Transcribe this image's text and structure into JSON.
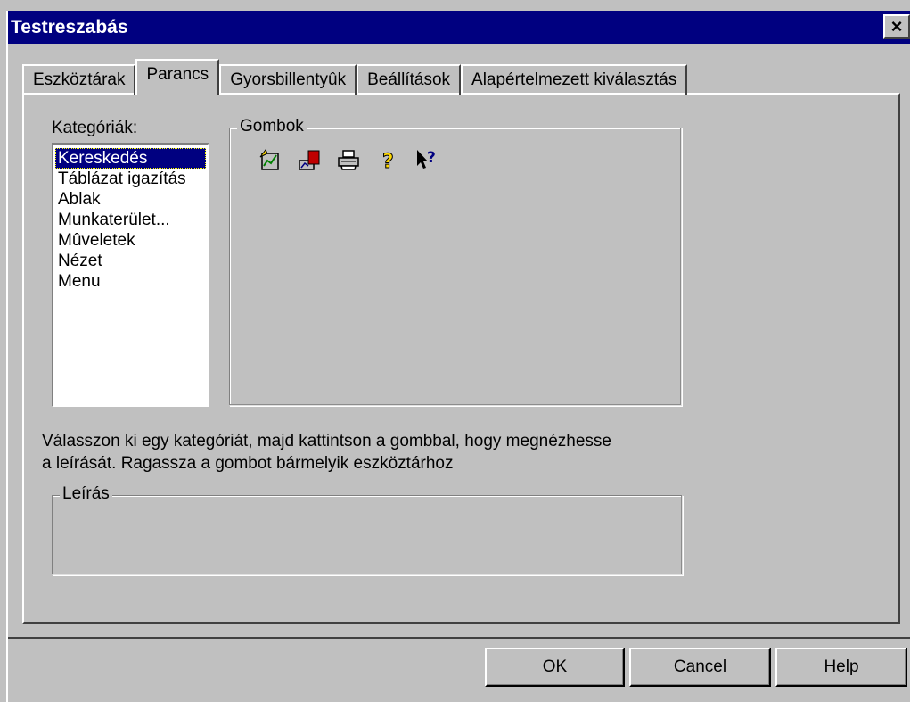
{
  "window": {
    "title": "Testreszabás",
    "close_label": "×"
  },
  "tabs": [
    {
      "label": "Eszköztárak"
    },
    {
      "label": "Parancs"
    },
    {
      "label": "Gyorsbillentyûk"
    },
    {
      "label": "Beállítások"
    },
    {
      "label": "Alapértelmezett kiválasztás"
    }
  ],
  "categories": {
    "label": "Kategóriák:",
    "items": [
      "Kereskedés",
      "Táblázat igazítás",
      "Ablak",
      "Munkaterület...",
      "Mûveletek",
      "Nézet",
      "Menu"
    ]
  },
  "buttons_group": {
    "title": "Gombok",
    "icons": [
      "trade-chart-icon",
      "chart-export-icon",
      "print-icon",
      "help-icon",
      "context-help-icon"
    ]
  },
  "instruction": {
    "line1": "Válasszon ki egy kategóriát, majd kattintson a gombbal, hogy megnézhesse",
    "line2": "a leírását. Ragassza a gombot bármelyik eszköztárhoz"
  },
  "description_group": {
    "title": "Leírás"
  },
  "footer": {
    "ok": "OK",
    "cancel": "Cancel",
    "help": "Help"
  }
}
